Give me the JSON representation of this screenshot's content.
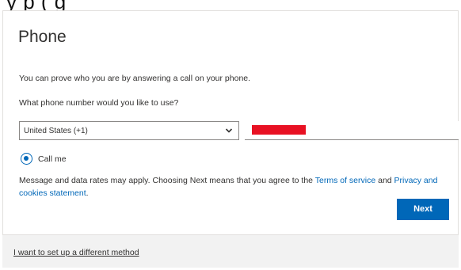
{
  "background_cutoff_text": "y       p                 (        g",
  "title": "Phone",
  "intro": "You can prove who you are by answering a call on your phone.",
  "question": "What phone number would you like to use?",
  "country_select": {
    "selected": "United States (+1)",
    "icon": "chevron-down-icon"
  },
  "phone_input": {
    "value": "",
    "redacted": true,
    "redaction_color": "#e81123"
  },
  "method_option": {
    "label": "Call me",
    "checked": true
  },
  "legal": {
    "prefix": "Message and data rates may apply. Choosing Next means that you agree to the ",
    "terms_link": "Terms of service",
    "middle": " and ",
    "privacy_link": "Privacy and cookies statement",
    "suffix": "."
  },
  "next_button": "Next",
  "alt_method_link": "I want to set up a different method",
  "colors": {
    "accent": "#0067b8",
    "footer_bg": "#f2f2f2",
    "text": "#323130"
  }
}
